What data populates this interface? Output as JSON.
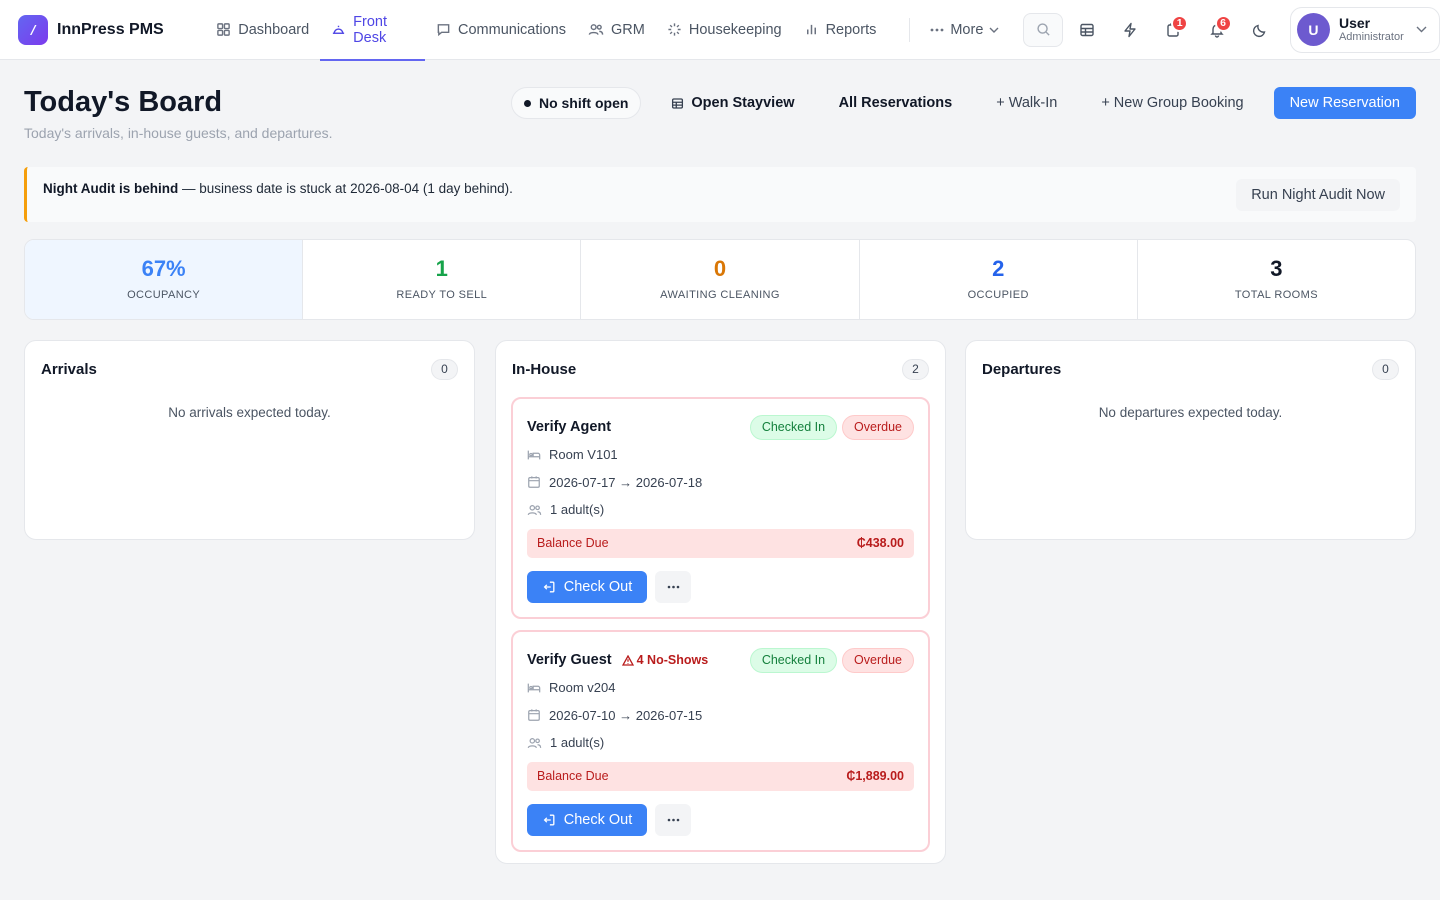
{
  "app": {
    "name": "InnPress PMS"
  },
  "nav": {
    "items": [
      {
        "label": "Dashboard",
        "icon": "grid-icon"
      },
      {
        "label": "Front Desk",
        "icon": "bell-desk-icon",
        "active": true
      },
      {
        "label": "Communications",
        "icon": "chat-icon"
      },
      {
        "label": "GRM",
        "icon": "users-icon"
      },
      {
        "label": "Housekeeping",
        "icon": "sparkle-icon"
      },
      {
        "label": "Reports",
        "icon": "bar-chart-icon"
      }
    ],
    "more_label": "More"
  },
  "toolbar": {
    "tasks_badge": "1",
    "notifications_badge": "6"
  },
  "user": {
    "name": "User",
    "role": "Administrator",
    "initial": "U"
  },
  "header": {
    "title": "Today's Board",
    "subtitle": "Today's arrivals, in-house guests, and departures.",
    "shift_status": "No shift open",
    "open_stayview": "Open Stayview",
    "all_reservations": "All Reservations",
    "walk_in": "+ Walk-In",
    "new_group_booking": "+ New Group Booking",
    "new_reservation": "New Reservation"
  },
  "alert": {
    "title": "Night Audit is behind",
    "message": " — business date is stuck at 2026-08-04 (1 day behind).",
    "action": "Run Night Audit Now",
    "accent_color": "#f59e0b"
  },
  "stats": [
    {
      "value": "67%",
      "label": "OCCUPANCY",
      "color": "#3b82f6"
    },
    {
      "value": "1",
      "label": "READY TO SELL",
      "color": "#16a34a"
    },
    {
      "value": "0",
      "label": "AWAITING CLEANING",
      "color": "#d97706"
    },
    {
      "value": "2",
      "label": "OCCUPIED",
      "color": "#2563eb"
    },
    {
      "value": "3",
      "label": "TOTAL ROOMS",
      "color": "#111827"
    }
  ],
  "arrivals": {
    "title": "Arrivals",
    "count": "0",
    "empty": "No arrivals expected today."
  },
  "inhouse": {
    "title": "In-House",
    "count": "2",
    "cards": [
      {
        "guest": "Verify Agent",
        "noshow": "",
        "status": "Checked In",
        "flag": "Overdue",
        "room": "Room V101",
        "dates": "2026-07-17 → 2026-07-18",
        "guests": "1 adult(s)",
        "balance_label": "Balance Due",
        "balance": "₵438.00",
        "checkout_label": "Check Out"
      },
      {
        "guest": "Verify Guest",
        "noshow": "4 No-Shows",
        "status": "Checked In",
        "flag": "Overdue",
        "room": "Room v204",
        "dates": "2026-07-10 → 2026-07-15",
        "guests": "1 adult(s)",
        "balance_label": "Balance Due",
        "balance": "₵1,889.00",
        "checkout_label": "Check Out"
      }
    ]
  },
  "departures": {
    "title": "Departures",
    "count": "0",
    "empty": "No departures expected today."
  }
}
